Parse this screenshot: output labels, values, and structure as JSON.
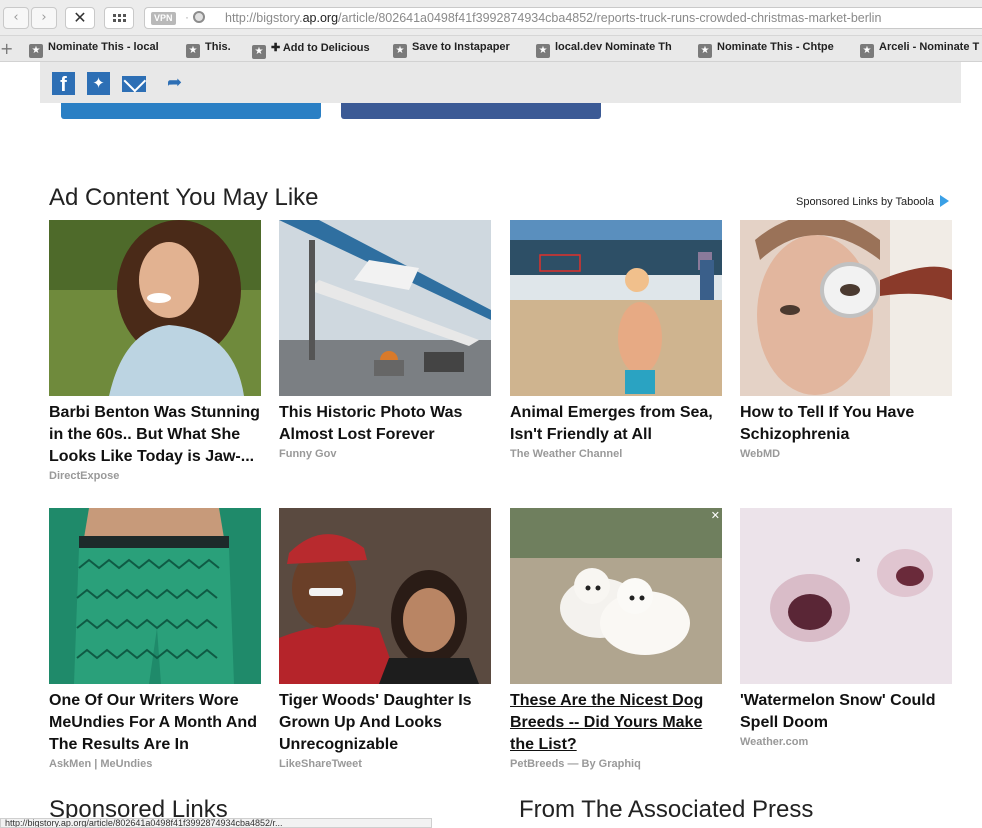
{
  "browser": {
    "vpn_label": "VPN",
    "url_prefix": "http://bigstory.",
    "url_domain": "ap.org",
    "url_path": "/article/802641a0498f41f3992874934cba4852/reports-truck-runs-crowded-christmas-market-berlin",
    "bookmarks": [
      "Nominate This - local",
      "This.",
      "✚ Add to Delicious",
      "Save to Instapaper",
      "local.dev Nominate Th",
      "Nominate This - Chtpe",
      "Arceli - Nominate T"
    ]
  },
  "ads": {
    "title": "Ad Content You May Like",
    "sponsored_label": "Sponsored Links by Taboola",
    "cards": [
      {
        "title": "Barbi Benton Was Stunning in the 60s.. But What She Looks Like Today is Jaw-...",
        "source": "DirectExpose"
      },
      {
        "title": "This Historic Photo Was Almost Lost Forever",
        "source": "Funny Gov"
      },
      {
        "title": "Animal Emerges from Sea, Isn't Friendly at All",
        "source": "The Weather Channel"
      },
      {
        "title": "How to Tell If You Have Schizophrenia",
        "source": "WebMD"
      },
      {
        "title": "One Of Our Writers Wore MeUndies For A Month And The Results Are In",
        "source": "AskMen | MeUndies"
      },
      {
        "title": "Tiger Woods' Daughter Is Grown Up And Looks Unrecognizable",
        "source": "LikeShareTweet"
      },
      {
        "title": "These Are the Nicest Dog Breeds -- Did Yours Make the List?",
        "source": "PetBreeds — By Graphiq"
      },
      {
        "title": "'Watermelon Snow' Could Spell Doom",
        "source": "Weather.com"
      }
    ]
  },
  "bottom": {
    "sponsored_links": "Sponsored Links",
    "from_ap": "From The Associated Press"
  },
  "status_text": "http://bigstory.ap.org/article/802641a0498f41f3992874934cba4852/r..."
}
